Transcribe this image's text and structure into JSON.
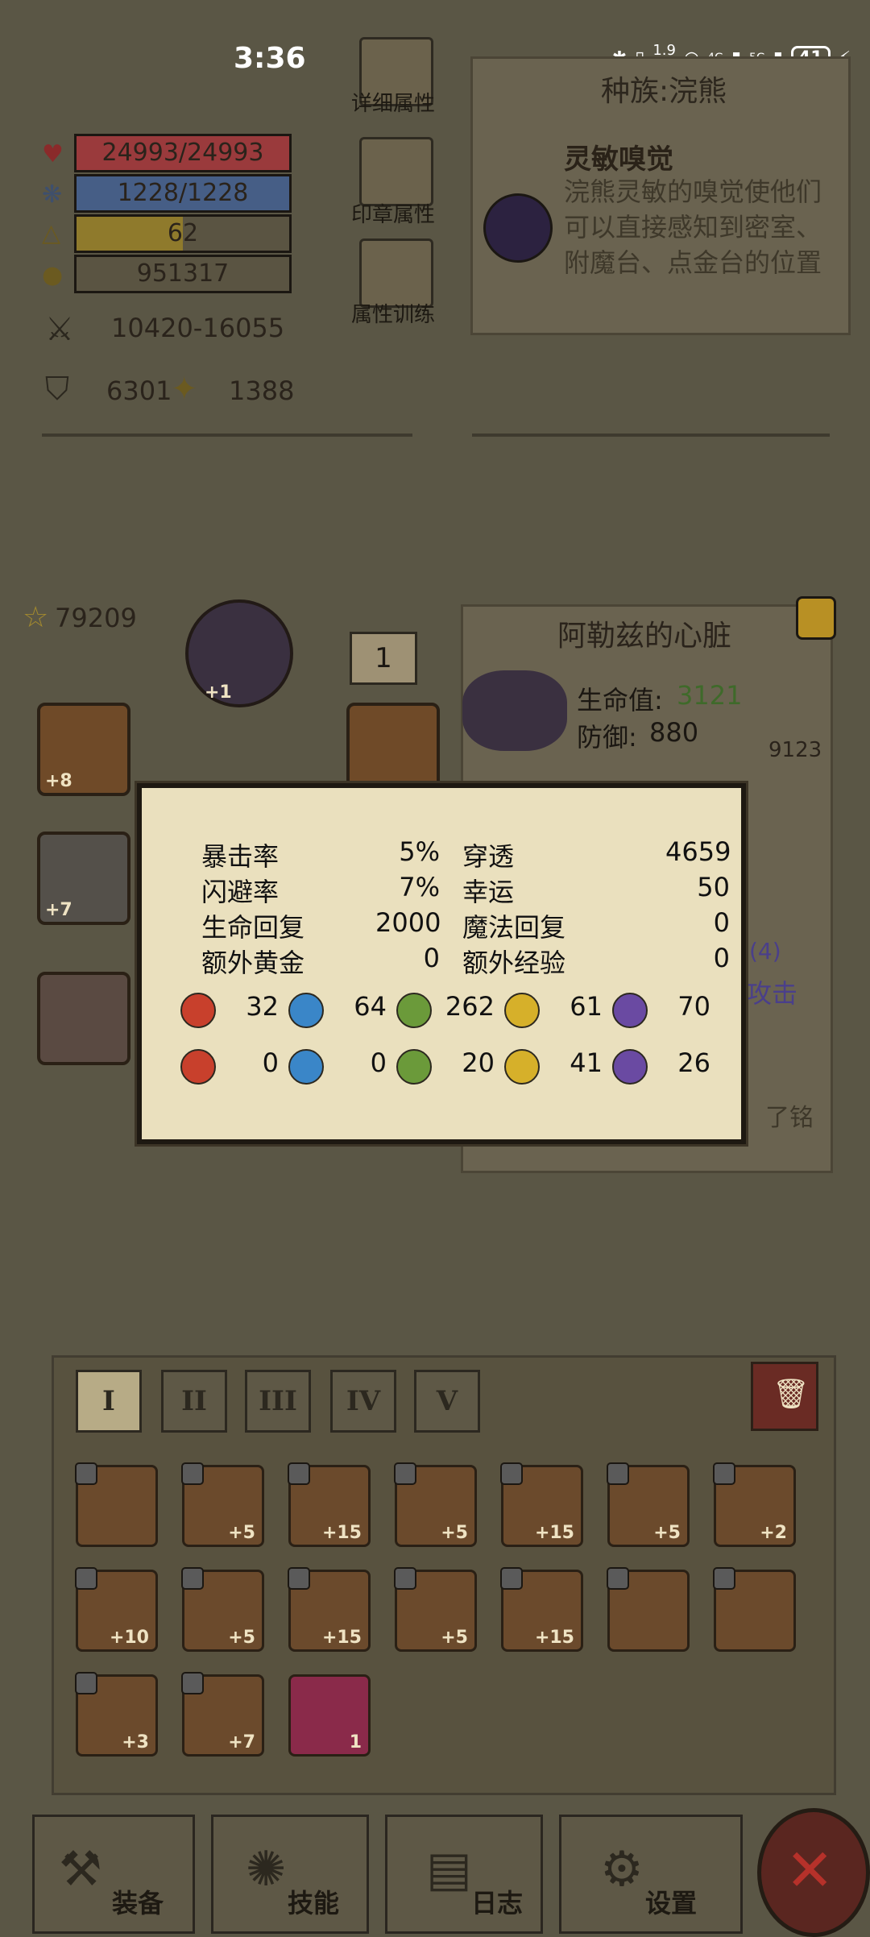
{
  "status_bar": {
    "time": "3:36",
    "net_speed": "1.9\nK/s",
    "battery": "41",
    "signal_a": "4G",
    "signal_b": "5G"
  },
  "hero_stats": {
    "hp": "24993/24993",
    "mp": "1228/1228",
    "level": "62",
    "gold": "951317",
    "attack": "10420-16055",
    "defense": "6301",
    "magic_power": "1388",
    "hp_fraction": 1.0,
    "mp_fraction": 1.0,
    "level_fraction": 0.5
  },
  "side_buttons": [
    {
      "label": "详细属性",
      "icon": "dots-icon"
    },
    {
      "label": "印章属性",
      "icon": "seal-icon"
    },
    {
      "label": "属性训练",
      "icon": "target-icon"
    }
  ],
  "race_panel": {
    "title": "种族:浣熊",
    "trait_title": "灵敏嗅觉",
    "trait_desc": "浣熊灵敏的嗅觉使他们可以直接感知到密室、附魔台、点金台的位置"
  },
  "gear": {
    "power": "79209",
    "helm_level": "+1",
    "slot_counter": "1",
    "items": [
      {
        "level": "+8"
      },
      {
        "level": "+7"
      },
      {
        "level": ""
      },
      {
        "level": ""
      }
    ]
  },
  "heart_panel": {
    "title": "阿勒兹的心脏",
    "hp_label": "生命值:",
    "hp_value": "3121",
    "def_label": "防御:",
    "def_value": "880",
    "power": "9123",
    "partial_a": "(4)",
    "partial_b": "攻击",
    "partial_c": "了铭"
  },
  "popup": {
    "stats": [
      {
        "label": "暴击率",
        "value": "5%"
      },
      {
        "label": "穿透",
        "value": "4659"
      },
      {
        "label": "闪避率",
        "value": "7%"
      },
      {
        "label": "幸运",
        "value": "50"
      },
      {
        "label": "生命回复",
        "value": "2000"
      },
      {
        "label": "魔法回复",
        "value": "0"
      },
      {
        "label": "额外黄金",
        "value": "0"
      },
      {
        "label": "额外经验",
        "value": "0"
      }
    ],
    "attack_elements": [
      {
        "icon": "fire-icon",
        "value": "32",
        "color": "#c8402c"
      },
      {
        "icon": "water-icon",
        "value": "64",
        "color": "#3a86c8"
      },
      {
        "icon": "leaf-icon",
        "value": "262",
        "color": "#6b9a3a"
      },
      {
        "icon": "lightning-icon",
        "value": "61",
        "color": "#d6b02a"
      },
      {
        "icon": "shadow-icon",
        "value": "70",
        "color": "#6a4aa2"
      }
    ],
    "resist_elements": [
      {
        "icon": "fire-shield-icon",
        "value": "0",
        "color": "#c8402c"
      },
      {
        "icon": "water-shield-icon",
        "value": "0",
        "color": "#3a86c8"
      },
      {
        "icon": "leaf-shield-icon",
        "value": "20",
        "color": "#6b9a3a"
      },
      {
        "icon": "lightning-shield-icon",
        "value": "41",
        "color": "#d6b02a"
      },
      {
        "icon": "shadow-shield-icon",
        "value": "26",
        "color": "#6a4aa2"
      }
    ]
  },
  "inventory": {
    "tabs": [
      "I",
      "II",
      "III",
      "IV",
      "V"
    ],
    "active_tab": "I",
    "items": [
      {
        "level": ""
      },
      {
        "level": "+5"
      },
      {
        "level": "+15"
      },
      {
        "level": "+5"
      },
      {
        "level": "+15"
      },
      {
        "level": "+5"
      },
      {
        "level": "+2"
      },
      {
        "level": "+10"
      },
      {
        "level": "+5"
      },
      {
        "level": "+15"
      },
      {
        "level": "+5"
      },
      {
        "level": "+15"
      },
      {
        "level": ""
      },
      {
        "level": ""
      },
      {
        "level": "+3"
      },
      {
        "level": "+7"
      },
      {
        "level": "1"
      }
    ]
  },
  "bottom_nav": [
    {
      "label": "装备",
      "icon": "axe-icon"
    },
    {
      "label": "技能",
      "icon": "skill-icon"
    },
    {
      "label": "日志",
      "icon": "book-icon"
    },
    {
      "label": "设置",
      "icon": "gear-icon"
    }
  ]
}
